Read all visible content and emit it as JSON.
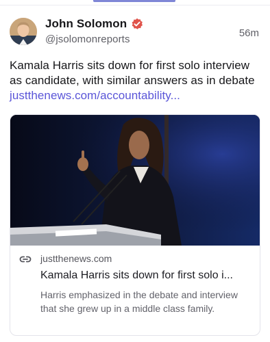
{
  "post": {
    "author": {
      "display_name": "John Solomon",
      "handle": "@jsolomonreports",
      "verified_icon": "verified-badge-icon",
      "verified_color": "#e0534a"
    },
    "time": "56m",
    "text": "Kamala Harris sits down for first solo interview as candidate, with similar answers as in debate",
    "link_text": "justthenews.com/accountability..."
  },
  "card": {
    "domain": "justthenews.com",
    "title": "Kamala Harris sits down for first solo i...",
    "description": "Harris emphasized in the debate and interview that she grew up in a middle class family.",
    "icon": "link-icon"
  },
  "colors": {
    "accent": "#5a55d8",
    "text": "#17171a",
    "muted": "#5f5f66",
    "border": "#e3e3ea"
  }
}
